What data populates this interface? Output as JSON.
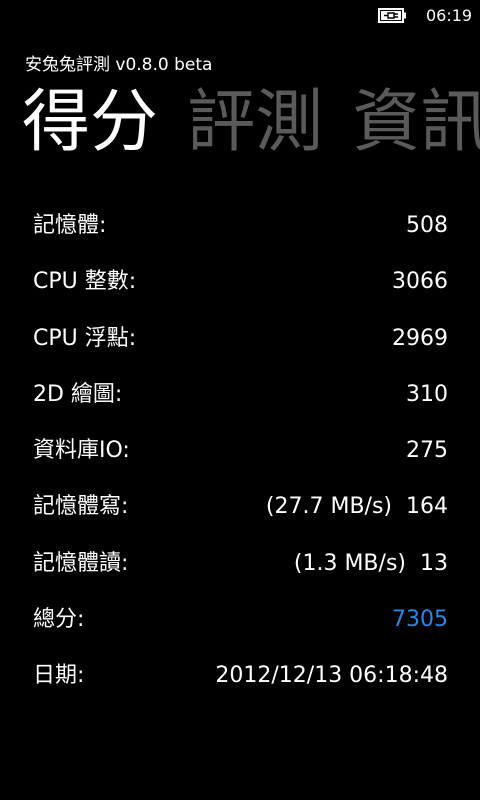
{
  "status_bar": {
    "battery_icon": "battery-charging-icon",
    "time": "06:19"
  },
  "app": {
    "title": "安兔兔評測 v0.8.0 beta"
  },
  "pivot": {
    "items": [
      {
        "label": "得分",
        "active": true
      },
      {
        "label": "評測",
        "active": false
      },
      {
        "label": "資訊",
        "active": false
      }
    ]
  },
  "results": {
    "memory": {
      "label": "記憶體:",
      "value": "508"
    },
    "cpu_integer": {
      "label": "CPU 整數:",
      "value": "3066"
    },
    "cpu_float": {
      "label": "CPU 浮點:",
      "value": "2969"
    },
    "graphics_2d": {
      "label": "2D 繪圖:",
      "value": "310"
    },
    "database_io": {
      "label": "資料庫IO:",
      "value": "275"
    },
    "memory_write": {
      "label": "記憶體寫:",
      "speed": "(27.7 MB/s)",
      "value": "164"
    },
    "memory_read": {
      "label": "記憶體讀:",
      "speed": "(1.3 MB/s)",
      "value": "13"
    },
    "total": {
      "label": "總分:",
      "value": "7305"
    },
    "date": {
      "label": "日期:",
      "value": "2012/12/13 06:18:48"
    }
  },
  "colors": {
    "background": "#000000",
    "text": "#ffffff",
    "inactive_pivot": "#5a5a5a",
    "accent": "#2b85e4"
  }
}
